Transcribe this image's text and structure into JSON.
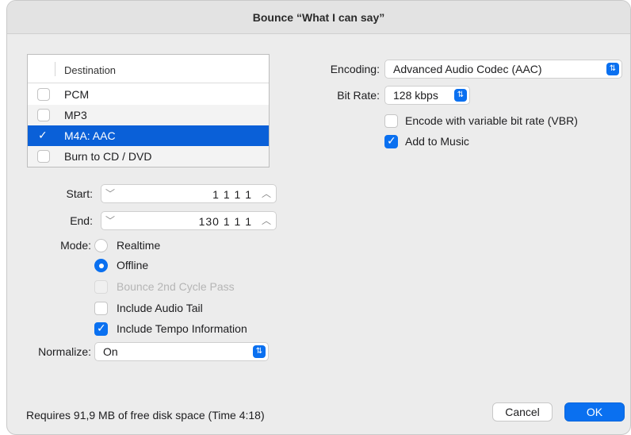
{
  "window": {
    "title": "Bounce “What I can say”"
  },
  "destination": {
    "header": "Destination",
    "items": [
      {
        "label": "PCM",
        "checked": false,
        "selected": false
      },
      {
        "label": "MP3",
        "checked": false,
        "selected": false
      },
      {
        "label": "M4A: AAC",
        "checked": true,
        "selected": true
      },
      {
        "label": "Burn to CD / DVD",
        "checked": false,
        "selected": false
      }
    ]
  },
  "start": {
    "label": "Start:",
    "value": "1 1 1     1"
  },
  "end": {
    "label": "End:",
    "value": "130 1 1     1"
  },
  "mode": {
    "label": "Mode:",
    "realtime": "Realtime",
    "offline": "Offline",
    "selected": "Offline"
  },
  "options": {
    "bounce_2nd_cycle": {
      "label": "Bounce 2nd Cycle Pass",
      "checked": false,
      "enabled": false
    },
    "include_audio_tail": {
      "label": "Include Audio Tail",
      "checked": false,
      "enabled": true
    },
    "include_tempo": {
      "label": "Include Tempo Information",
      "checked": true,
      "enabled": true
    }
  },
  "normalize": {
    "label": "Normalize:",
    "value": "On"
  },
  "encoding": {
    "label": "Encoding:",
    "value": "Advanced Audio Codec (AAC)"
  },
  "bitrate": {
    "label": "Bit Rate:",
    "value": "128 kbps"
  },
  "vbr": {
    "label": "Encode with variable bit rate (VBR)",
    "checked": false
  },
  "add_to_music": {
    "label": "Add to Music",
    "checked": true
  },
  "footer": {
    "status": "Requires 91,9 MB of free disk space  (Time 4:18)"
  },
  "buttons": {
    "cancel": "Cancel",
    "ok": "OK"
  },
  "colors": {
    "accent": "#0a70f0",
    "selection": "#0a60d8"
  }
}
